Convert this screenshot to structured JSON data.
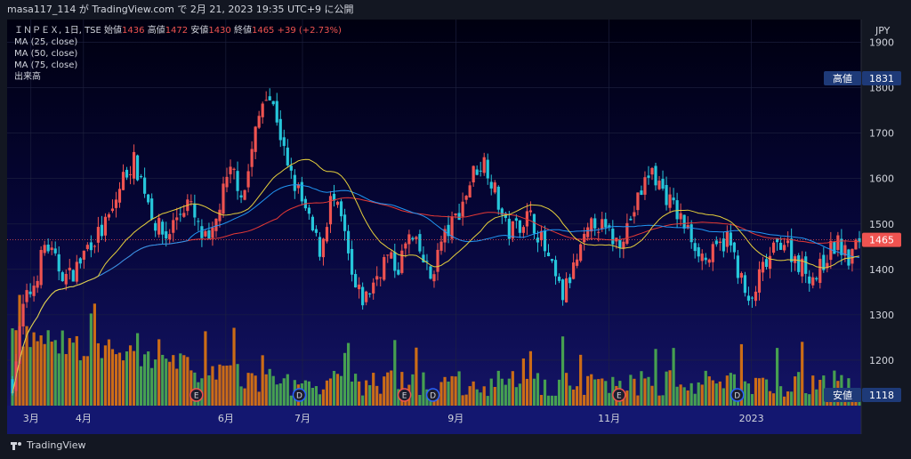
{
  "header": {
    "attribution": "masa117_114 が TradingView.com で 2月 21, 2023 19:35 UTC+9 に公開"
  },
  "legend": {
    "symbol": "ＩＮＰＥＸ, 1日, TSE",
    "open_label": "始値",
    "open": "1436",
    "high_label": "高値",
    "high": "1472",
    "low_label": "安値",
    "low": "1430",
    "close_label": "終値",
    "close": "1465",
    "change": "+39 (+2.73%)",
    "ma25": "MA (25, close)",
    "ma50": "MA (50, close)",
    "ma75": "MA (75, close)",
    "volume": "出来高"
  },
  "footer": {
    "brand": "TradingView"
  },
  "colors": {
    "up": "#ef5350",
    "down": "#26c6da",
    "vol_up": "#e0770f",
    "vol_down": "#4caf50",
    "ma25": "#e6d03c",
    "ma50": "#2196f3",
    "ma75": "#e53935",
    "label_bg": "#1e3a78"
  },
  "chart_data": {
    "type": "candlestick",
    "currency": "JPY",
    "ylim": [
      1100,
      1950
    ],
    "yticks": [
      1200,
      1300,
      1400,
      1500,
      1600,
      1700,
      1800,
      1900
    ],
    "yticks_top_label": "1900",
    "y_unit_label": "JPY",
    "x_ticks": [
      "3月",
      "4月",
      "6月",
      "7月",
      "9月",
      "11月",
      "2023"
    ],
    "x_tick_positions": [
      0.06,
      0.3,
      0.95,
      1.3,
      2.0,
      2.7,
      3.35
    ],
    "current_price": {
      "label": "1465",
      "value": 1465
    },
    "high_marker": {
      "label": "高値",
      "value": "1831",
      "price": 1831
    },
    "low_marker": {
      "label": "安値",
      "value": "1118",
      "price": 1118
    },
    "events": [
      {
        "type": "E",
        "at": 0.84
      },
      {
        "type": "D",
        "at": 1.31
      },
      {
        "type": "E",
        "at": 1.79
      },
      {
        "type": "D",
        "at": 1.92
      },
      {
        "type": "E",
        "at": 2.77
      },
      {
        "type": "D",
        "at": 3.31
      },
      {
        "type": "E",
        "at": 3.78
      }
    ],
    "close_path": [
      [
        0,
        1150
      ],
      [
        0.05,
        1320
      ],
      [
        0.1,
        1370
      ],
      [
        0.15,
        1460
      ],
      [
        0.2,
        1410
      ],
      [
        0.25,
        1380
      ],
      [
        0.3,
        1410
      ],
      [
        0.35,
        1460
      ],
      [
        0.4,
        1480
      ],
      [
        0.45,
        1520
      ],
      [
        0.5,
        1600
      ],
      [
        0.55,
        1640
      ],
      [
        0.6,
        1580
      ],
      [
        0.65,
        1500
      ],
      [
        0.7,
        1470
      ],
      [
        0.75,
        1520
      ],
      [
        0.8,
        1550
      ],
      [
        0.85,
        1480
      ],
      [
        0.9,
        1450
      ],
      [
        0.95,
        1560
      ],
      [
        1.0,
        1620
      ],
      [
        1.05,
        1560
      ],
      [
        1.1,
        1690
      ],
      [
        1.15,
        1800
      ],
      [
        1.2,
        1740
      ],
      [
        1.25,
        1620
      ],
      [
        1.3,
        1570
      ],
      [
        1.35,
        1500
      ],
      [
        1.4,
        1440
      ],
      [
        1.45,
        1560
      ],
      [
        1.5,
        1500
      ],
      [
        1.55,
        1360
      ],
      [
        1.6,
        1330
      ],
      [
        1.65,
        1380
      ],
      [
        1.7,
        1430
      ],
      [
        1.75,
        1400
      ],
      [
        1.8,
        1470
      ],
      [
        1.85,
        1440
      ],
      [
        1.9,
        1380
      ],
      [
        1.95,
        1460
      ],
      [
        2.0,
        1500
      ],
      [
        2.05,
        1550
      ],
      [
        2.1,
        1620
      ],
      [
        2.15,
        1640
      ],
      [
        2.2,
        1560
      ],
      [
        2.25,
        1480
      ],
      [
        2.3,
        1500
      ],
      [
        2.35,
        1520
      ],
      [
        2.4,
        1470
      ],
      [
        2.45,
        1400
      ],
      [
        2.5,
        1340
      ],
      [
        2.55,
        1400
      ],
      [
        2.6,
        1460
      ],
      [
        2.65,
        1510
      ],
      [
        2.7,
        1480
      ],
      [
        2.75,
        1460
      ],
      [
        2.8,
        1500
      ],
      [
        2.85,
        1560
      ],
      [
        2.9,
        1620
      ],
      [
        2.95,
        1580
      ],
      [
        3.0,
        1540
      ],
      [
        3.05,
        1500
      ],
      [
        3.1,
        1460
      ],
      [
        3.15,
        1420
      ],
      [
        3.2,
        1440
      ],
      [
        3.25,
        1470
      ],
      [
        3.3,
        1400
      ],
      [
        3.35,
        1310
      ],
      [
        3.4,
        1390
      ],
      [
        3.45,
        1430
      ],
      [
        3.5,
        1470
      ],
      [
        3.55,
        1430
      ],
      [
        3.6,
        1400
      ],
      [
        3.65,
        1380
      ],
      [
        3.7,
        1430
      ],
      [
        3.75,
        1460
      ],
      [
        3.8,
        1420
      ],
      [
        3.85,
        1465
      ]
    ]
  }
}
